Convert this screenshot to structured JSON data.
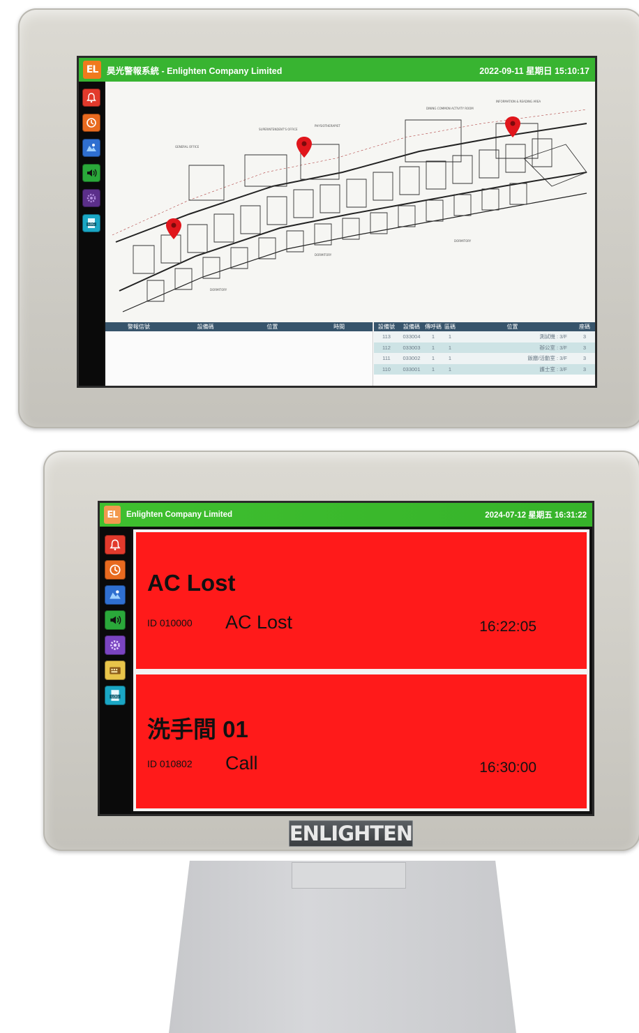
{
  "colors": {
    "title_green": "#38b431",
    "alarm_red": "#ff1a1a",
    "logo_orange": "#f07a1d",
    "table_header": "#37546b"
  },
  "top_device": {
    "logo": "EL",
    "title": "昊光警報系統 - Enlighten Company Limited",
    "datetime": "2022-09-11 星期日 15:10:17",
    "sidebar_icons": [
      "alarm-bell-icon",
      "history-icon",
      "map-icon",
      "speaker-icon",
      "settings-icon",
      "log-icon"
    ],
    "alarm_table": {
      "headers": [
        "警報信號",
        "設備碼",
        "位置",
        "時間"
      ]
    },
    "device_table": {
      "headers": [
        "設備號",
        "設備碼",
        "傳呼碼",
        "區碼",
        "位置",
        "座碼"
      ],
      "rows": [
        [
          "113",
          "033004",
          "1",
          "1",
          "測試機 : 3/F",
          "3"
        ],
        [
          "112",
          "033003",
          "1",
          "1",
          "辦公室 : 3/F",
          "3"
        ],
        [
          "111",
          "033002",
          "1",
          "1",
          "飯廳/活動室 : 3/F",
          "3"
        ],
        [
          "110",
          "033001",
          "1",
          "1",
          "護士室 : 3/F",
          "3"
        ]
      ]
    }
  },
  "bottom_device": {
    "logo": "EL",
    "title": "Enlighten Company Limited",
    "datetime": "2024-07-12 星期五 16:31:22",
    "sidebar_icons": [
      "alarm-bell-icon",
      "history-icon",
      "map-icon",
      "speaker-icon",
      "settings-icon",
      "keypad-icon",
      "log-icon"
    ],
    "alarms": [
      {
        "title": "AC Lost",
        "id": "ID 010000",
        "type": "AC Lost",
        "time": "16:22:05"
      },
      {
        "title": "洗手間 01",
        "id": "ID 010802",
        "type": "Call",
        "time": "16:30:00"
      }
    ],
    "brand": "ENLIGHTEN"
  }
}
